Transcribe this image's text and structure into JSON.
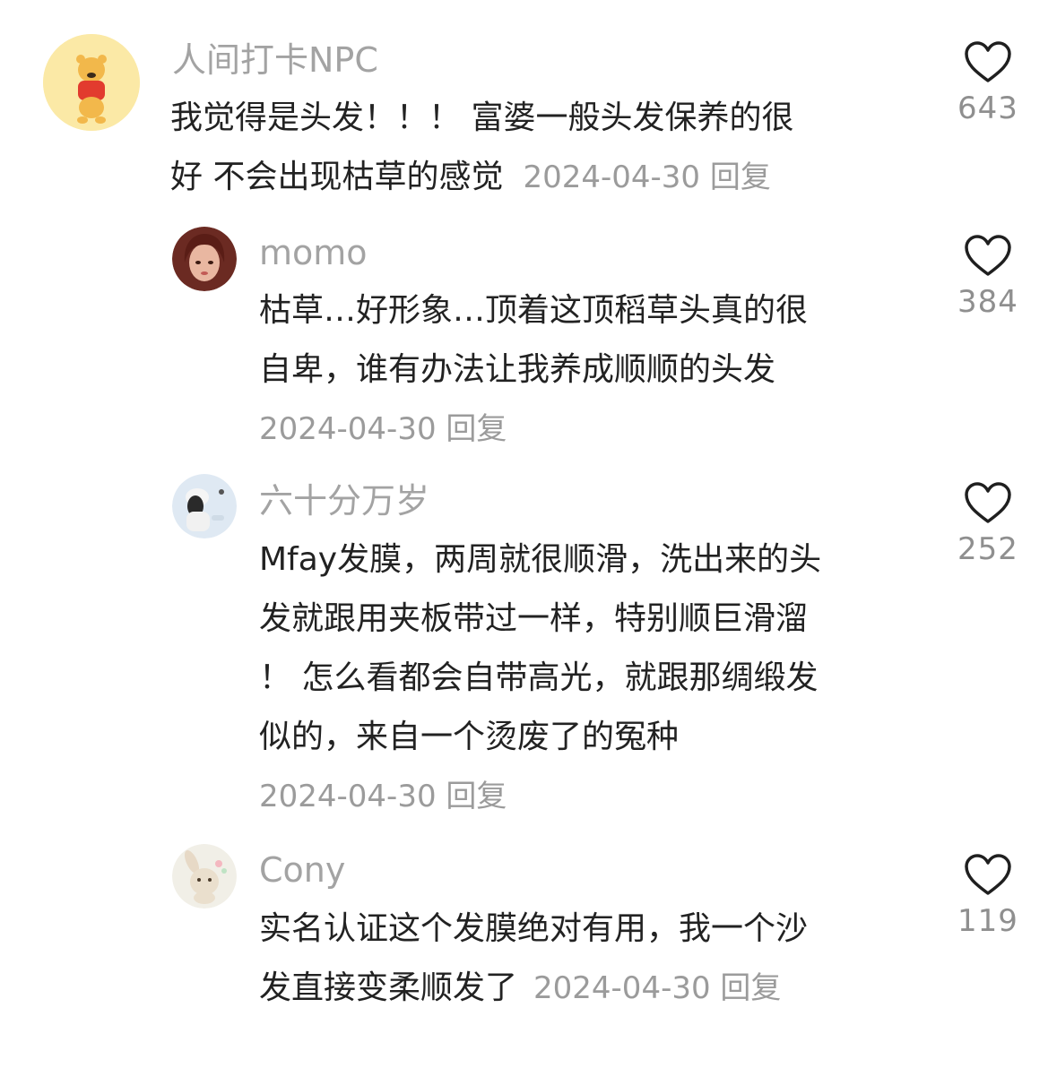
{
  "comments": [
    {
      "username": "人间打卡NPC",
      "avatar": "winnie-the-pooh-avatar",
      "lines": [
        "我觉得是头发！！！ 富婆一般头发保养的很",
        "好 不会出现枯草的感觉"
      ],
      "date": "2024-04-30",
      "reply": "回复",
      "likes": "643"
    },
    {
      "username": "momo",
      "avatar": "girl-portrait-avatar",
      "lines": [
        "枯草…好形象…顶着这顶稻草头真的很",
        "自卑，谁有办法让我养成顺顺的头发"
      ],
      "date": "2024-04-30",
      "reply": "回复",
      "likes": "384"
    },
    {
      "username": "六十分万岁",
      "avatar": "snow-girl-avatar",
      "lines": [
        "Mfay发膜，两周就很顺滑，洗出来的头",
        "发就跟用夹板带过一样，特别顺巨滑溜",
        "！ 怎么看都会自带高光，就跟那绸缎发",
        "似的，来自一个烫废了的冤种"
      ],
      "date": "2024-04-30",
      "reply": "回复",
      "likes": "252"
    },
    {
      "username": "Cony",
      "avatar": "bunny-avatar",
      "lines": [
        "实名认证这个发膜绝对有用，我一个沙",
        "发直接变柔顺发了"
      ],
      "date": "2024-04-30",
      "reply": "回复",
      "likes": "119"
    }
  ],
  "icons": {
    "like": "heart-outline-icon"
  },
  "colors": {
    "text": "#222222",
    "muted": "#a3a3a3",
    "background": "#ffffff"
  }
}
